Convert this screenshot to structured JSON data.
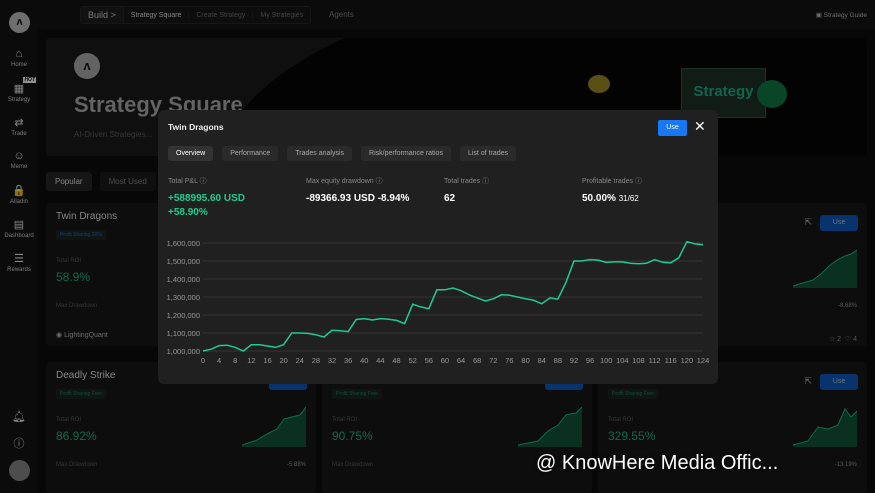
{
  "sidebar": {
    "items": [
      {
        "label": "Home",
        "icon": "⌂"
      },
      {
        "label": "Strategy",
        "icon": "▦",
        "badge": "HOT"
      },
      {
        "label": "Trade",
        "icon": "⇄"
      },
      {
        "label": "Meme",
        "icon": "☺"
      },
      {
        "label": "Alladin",
        "icon": "🔒"
      },
      {
        "label": "Dashboard",
        "icon": "▤"
      },
      {
        "label": "Rewards",
        "icon": "☰"
      }
    ]
  },
  "topbar": {
    "build": "Build >",
    "crumbs": [
      "Strategy Square",
      "Create Strategy",
      "My Strategies"
    ],
    "agents": "Agents",
    "guide": "Strategy Guide"
  },
  "banner": {
    "title": "Strategy Square",
    "subtitle": "AI-Driven Strategies...",
    "art_text": "Strategy"
  },
  "filters": [
    "Popular",
    "Most Used"
  ],
  "cards": [
    {
      "name": "Twin Dragons",
      "tag": "Profit Sharing 20%",
      "roi_label": "Total ROI",
      "roi": "58.9%",
      "md_label": "Max Drawdown",
      "md": "",
      "author": "LightingQuant"
    },
    {
      "name": "",
      "use": "Use",
      "md": "-8.68%",
      "stars": "☆ 2",
      "likes": "♡ 4"
    },
    {
      "name": "Deadly Strike",
      "tag": "Profit Sharing Free",
      "roi_label": "Total ROI",
      "roi": "86.92%",
      "md_label": "Max Drawdown",
      "md": "-5.88%",
      "use": "Use"
    },
    {
      "tag": "Profit Sharing Free",
      "roi_label": "Total ROI",
      "roi": "90.75%",
      "md_label": "Max Drawdown",
      "use": "Use"
    },
    {
      "tag": "Profit Sharing Free",
      "roi_label": "Total ROI",
      "roi": "329.55%",
      "md_label": "Max Drawdown",
      "md": "-13.19%",
      "use": "Use"
    }
  ],
  "modal": {
    "title": "Twin Dragons",
    "use": "Use",
    "close": "✕",
    "tabs": [
      "Overview",
      "Performance",
      "Trades analysis",
      "Risk/performance ratios",
      "List of trades"
    ],
    "stats": [
      {
        "label": "Total P&L ⓘ",
        "value": "+588995.60 USD",
        "value2": "+58.90%"
      },
      {
        "label": "Max equity drawdown ⓘ",
        "value": "-89366.93 USD -8.94%"
      },
      {
        "label": "Total trades ⓘ",
        "value": "62"
      },
      {
        "label": "Profitable trades ⓘ",
        "value": "50.00%",
        "sub": "31/62"
      }
    ]
  },
  "chart_data": {
    "type": "line",
    "ylim": [
      1000000,
      1600000
    ],
    "yticks": [
      1000000,
      1100000,
      1200000,
      1300000,
      1400000,
      1500000,
      1600000
    ],
    "ytick_labels": [
      "1,000,000",
      "1,100,000",
      "1,200,000",
      "1,300,000",
      "1,400,000",
      "1,500,000",
      "1,600,000"
    ],
    "xlim": [
      0,
      124
    ],
    "xticks": [
      0,
      4,
      8,
      12,
      16,
      20,
      24,
      28,
      32,
      36,
      40,
      44,
      48,
      52,
      56,
      60,
      64,
      68,
      72,
      76,
      80,
      84,
      88,
      92,
      96,
      100,
      104,
      108,
      112,
      116,
      120,
      124
    ],
    "color": "#1fcc8e",
    "x": [
      0,
      2,
      4,
      6,
      8,
      10,
      12,
      14,
      16,
      18,
      20,
      22,
      24,
      26,
      28,
      30,
      32,
      34,
      36,
      38,
      40,
      42,
      44,
      46,
      48,
      50,
      52,
      54,
      56,
      58,
      60,
      62,
      64,
      66,
      68,
      70,
      72,
      74,
      76,
      78,
      80,
      82,
      84,
      86,
      88,
      90,
      92,
      94,
      96,
      98,
      100,
      102,
      104,
      106,
      108,
      110,
      112,
      114,
      116,
      118,
      120,
      122,
      124
    ],
    "y": [
      1000,
      1010,
      1030,
      1032,
      1020,
      1000,
      1035,
      1035,
      1028,
      1020,
      1035,
      1100,
      1100,
      1098,
      1090,
      1078,
      1115,
      1112,
      1108,
      1175,
      1180,
      1172,
      1180,
      1176,
      1170,
      1152,
      1260,
      1245,
      1235,
      1340,
      1340,
      1350,
      1335,
      1312,
      1295,
      1278,
      1290,
      1312,
      1310,
      1300,
      1290,
      1282,
      1262,
      1295,
      1288,
      1380,
      1500,
      1500,
      1508,
      1505,
      1492,
      1495,
      1495,
      1487,
      1485,
      1487,
      1507,
      1493,
      1490,
      1518,
      1607,
      1595,
      1590
    ],
    "y_unit": "thousands USD"
  },
  "watermark": "@ KnowHere Media Offic..."
}
